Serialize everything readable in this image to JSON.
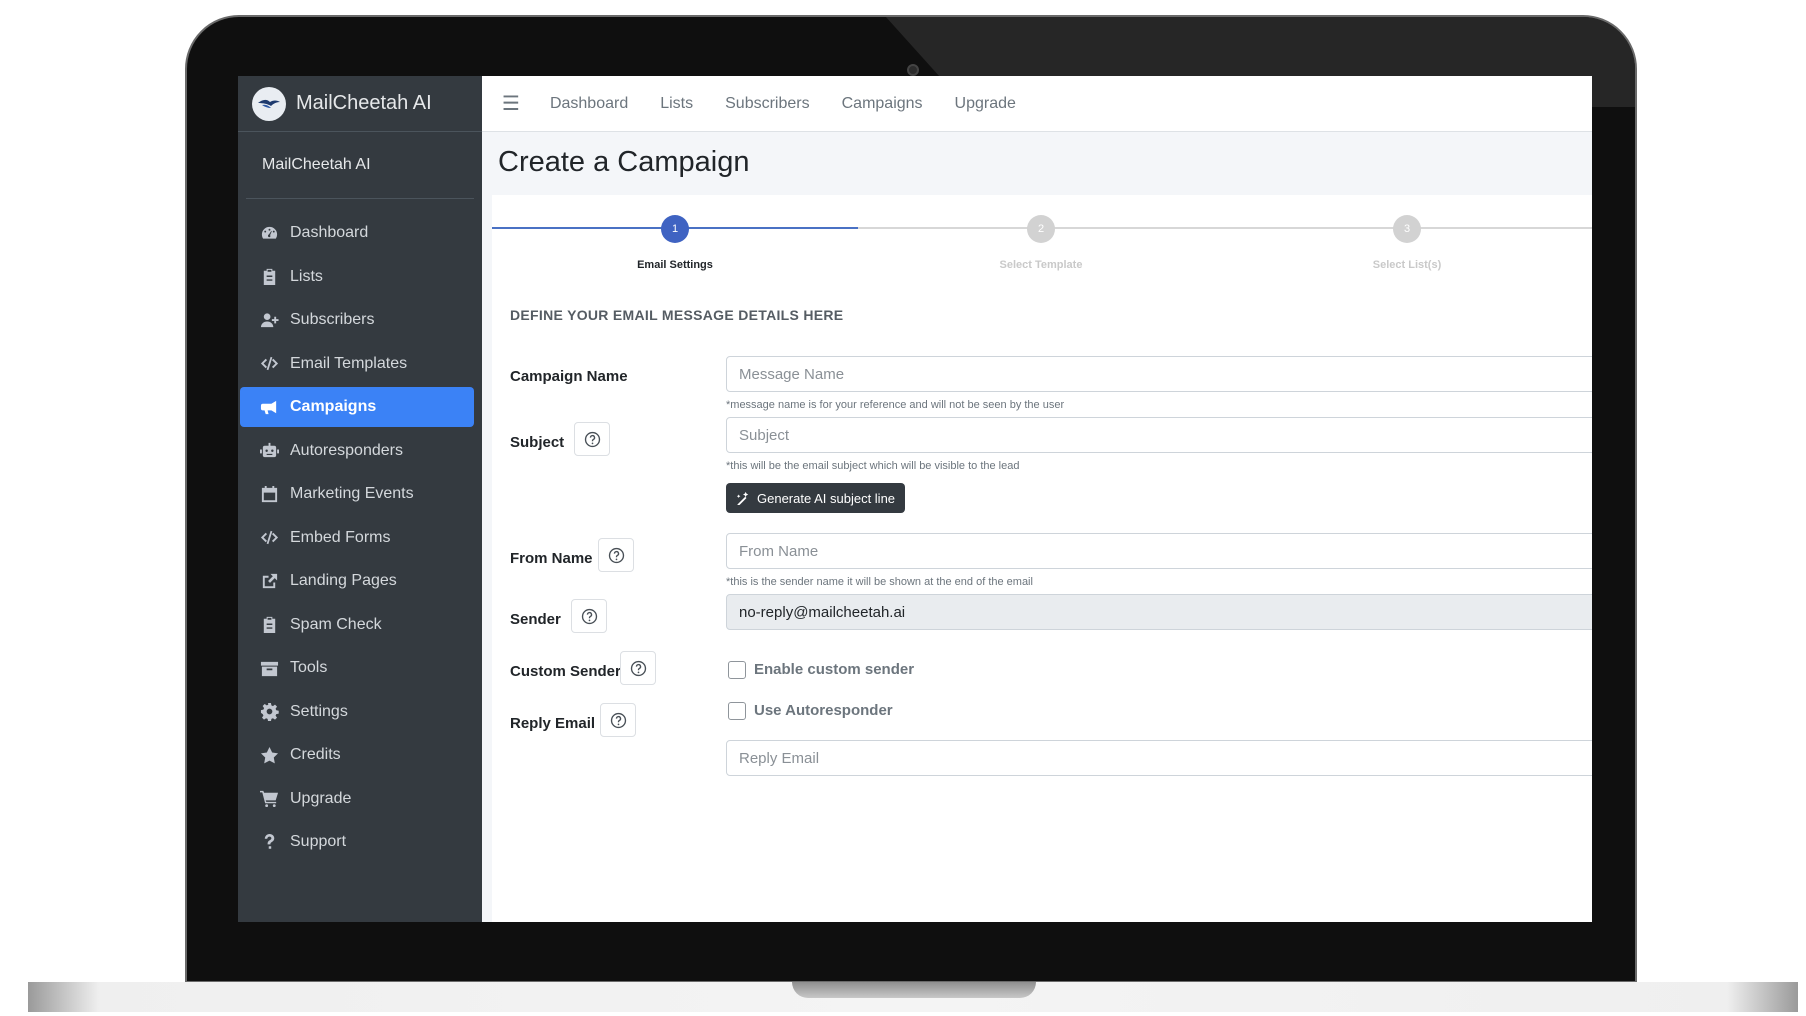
{
  "brand": {
    "name": "MailCheetah AI"
  },
  "user": {
    "name": "MailCheetah AI"
  },
  "sidebar": {
    "items": [
      {
        "label": "Dashboard",
        "icon": "tachometer-icon"
      },
      {
        "label": "Lists",
        "icon": "clipboard-icon"
      },
      {
        "label": "Subscribers",
        "icon": "user-plus-icon"
      },
      {
        "label": "Email Templates",
        "icon": "code-icon"
      },
      {
        "label": "Campaigns",
        "icon": "bullhorn-icon",
        "active": true
      },
      {
        "label": "Autoresponders",
        "icon": "robot-icon"
      },
      {
        "label": "Marketing Events",
        "icon": "calendar-icon"
      },
      {
        "label": "Embed Forms",
        "icon": "code-icon"
      },
      {
        "label": "Landing Pages",
        "icon": "external-link-icon"
      },
      {
        "label": "Spam Check",
        "icon": "clipboard-icon"
      },
      {
        "label": "Tools",
        "icon": "archive-icon"
      },
      {
        "label": "Settings",
        "icon": "gear-icon"
      },
      {
        "label": "Credits",
        "icon": "star-icon"
      },
      {
        "label": "Upgrade",
        "icon": "cart-icon"
      },
      {
        "label": "Support",
        "icon": "question-icon"
      }
    ]
  },
  "topnav": {
    "links": [
      "Dashboard",
      "Lists",
      "Subscribers",
      "Campaigns",
      "Upgrade"
    ]
  },
  "page": {
    "title": "Create a Campaign"
  },
  "stepper": {
    "steps": [
      {
        "number": "1",
        "label": "Email Settings",
        "active": true
      },
      {
        "number": "2",
        "label": "Select Template",
        "active": false
      },
      {
        "number": "3",
        "label": "Select List(s)",
        "active": false
      }
    ]
  },
  "form": {
    "section_title": "DEFINE YOUR EMAIL MESSAGE DETAILS HERE",
    "campaign_name": {
      "label": "Campaign Name",
      "placeholder": "Message Name",
      "hint": "*message name is for your reference and will not be seen by the user"
    },
    "subject": {
      "label": "Subject",
      "placeholder": "Subject",
      "hint": "*this will be the email subject which will be visible to the lead"
    },
    "ai_button": "Generate AI subject line",
    "from_name": {
      "label": "From Name",
      "placeholder": "From Name",
      "hint": "*this is the sender name it will be shown at the end of the email"
    },
    "sender": {
      "label": "Sender",
      "value": "no-reply@mailcheetah.ai"
    },
    "custom_sender": {
      "label": "Custom Sender",
      "checkbox_label": "Enable custom sender"
    },
    "reply_email": {
      "label": "Reply Email",
      "checkbox_label": "Use Autoresponder",
      "placeholder": "Reply Email"
    }
  },
  "colors": {
    "sidebar_bg": "#343a40",
    "accent": "#3b82f6",
    "step_active": "#3f63c2"
  }
}
